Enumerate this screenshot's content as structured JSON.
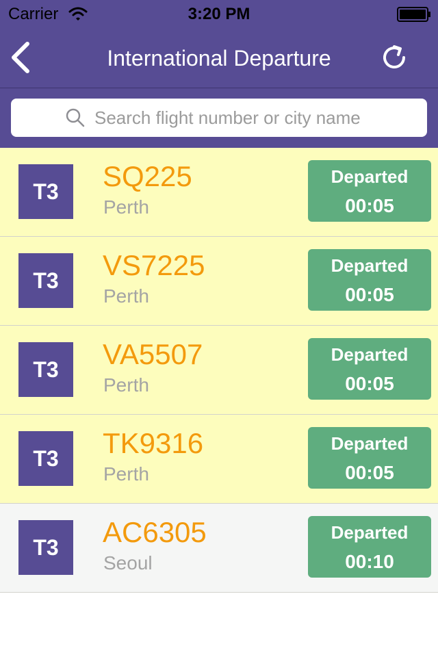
{
  "statusbar": {
    "carrier": "Carrier",
    "time": "3:20 PM"
  },
  "navbar": {
    "title": "International Departure",
    "back_icon": "chevron-left-icon",
    "refresh_icon": "refresh-icon"
  },
  "search": {
    "placeholder": "Search flight number or city name",
    "value": ""
  },
  "colors": {
    "brand": "#574c94",
    "row_highlight": "#fdfdbd",
    "row_normal": "#f5f6f5",
    "flight_number": "#f39a0d",
    "status_green": "#5fad7f"
  },
  "flights": [
    {
      "terminal": "T3",
      "number": "SQ225",
      "city": "Perth",
      "status": "Departed",
      "time": "00:05"
    },
    {
      "terminal": "T3",
      "number": "VS7225",
      "city": "Perth",
      "status": "Departed",
      "time": "00:05"
    },
    {
      "terminal": "T3",
      "number": "VA5507",
      "city": "Perth",
      "status": "Departed",
      "time": "00:05"
    },
    {
      "terminal": "T3",
      "number": "TK9316",
      "city": "Perth",
      "status": "Departed",
      "time": "00:05"
    },
    {
      "terminal": "T3",
      "number": "AC6305",
      "city": "Seoul",
      "status": "Departed",
      "time": "00:10"
    }
  ]
}
